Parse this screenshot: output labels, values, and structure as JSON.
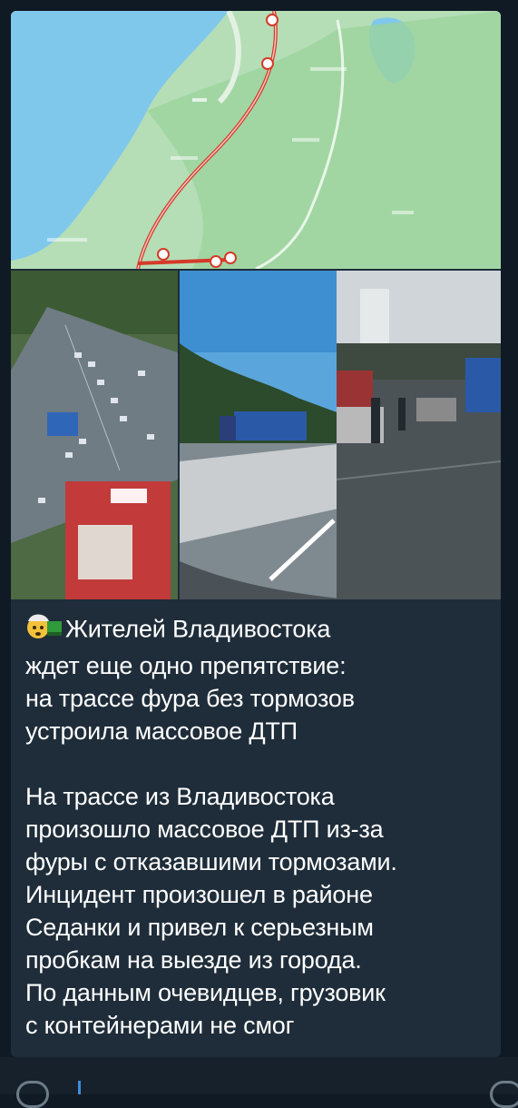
{
  "post": {
    "emoji_row": [
      "exploding-head-emoji",
      "truck-emoji"
    ],
    "headline_lines": [
      "Жителей Владивостока",
      "ждет еще одно препятствие:",
      "на трассе фура без тормозов",
      "устроила массовое ДТП"
    ],
    "body_lines": [
      "На трассе из Владивостока",
      "произошло массовое ДТП из-за",
      "фуры с отказавшими тормозами.",
      "Инцидент произошел в районе",
      "Седанки и привел к серьезным",
      "пробкам на выезде из города.",
      "По данным очевидцев, грузовик",
      "с контейнерами не смог"
    ]
  },
  "colors": {
    "background": "#0f1a24",
    "bubble": "#1f2d3a",
    "text": "#ffffff",
    "accent": "#3e8edb"
  }
}
